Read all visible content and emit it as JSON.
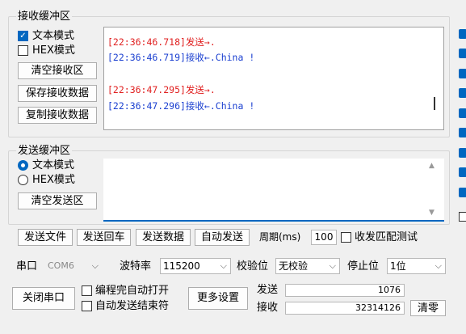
{
  "receive": {
    "title": "接收缓冲区",
    "text_mode": "文本模式",
    "hex_mode": "HEX模式",
    "clear_btn": "清空接收区",
    "save_btn": "保存接收数据",
    "copy_btn": "复制接收数据",
    "log": [
      {
        "text": "[22:36:46.718]发送→.",
        "color": "#e02020"
      },
      {
        "text": "[22:36:46.719]接收←.China !",
        "color": "#1a3fd0"
      },
      {
        "text": "[22:36:47.295]发送→.",
        "color": "#e02020"
      },
      {
        "text": "[22:36:47.296]接收←.China !",
        "color": "#1a3fd0"
      }
    ]
  },
  "send": {
    "title": "发送缓冲区",
    "text_mode": "文本模式",
    "hex_mode": "HEX模式",
    "clear_btn": "清空发送区"
  },
  "actions": {
    "send_file": "发送文件",
    "send_newline": "发送回车",
    "send_data": "发送数据",
    "auto_send": "自动发送",
    "period_label": "周期(ms)",
    "period_value": "100",
    "match_test": "收发匹配测试"
  },
  "port": {
    "port_label": "串口",
    "port_value": "COM6",
    "baud_label": "波特率",
    "baud_value": "115200",
    "parity_label": "校验位",
    "parity_value": "无校验",
    "stop_label": "停止位",
    "stop_value": "1位"
  },
  "bottom": {
    "close_port": "关闭串口",
    "auto_open": "编程完自动打开",
    "auto_send_end": "自动发送结束符",
    "more_settings": "更多设置",
    "sent_label": "发送",
    "sent_value": "1076",
    "recv_label": "接收",
    "recv_value": "32314126",
    "clear_btn": "清零"
  },
  "colors": {
    "accent": "#0067c0"
  }
}
